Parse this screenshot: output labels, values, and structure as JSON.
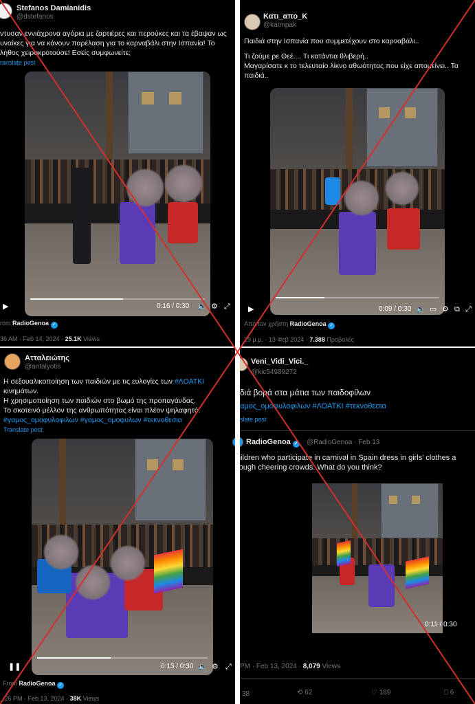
{
  "posts": [
    {
      "name": "Stefanos Damianidis",
      "handle": "@dstefanos",
      "text_lines": [
        "ντυσαν εννιάχρονα αγόρια με ζαρτιέρες και περούκες και τα έβαψαν ως",
        "υναίκες για να κάνουν παρέλαση για το καρναβάλι στην Ισπανία! Το",
        "λήθος χειροκροτούσε! Εσείς συμφωνείτε;"
      ],
      "translate": "ranslate post",
      "time": "0:16 / 0:30",
      "progress": 0.53,
      "source_prefix": "rom",
      "source_name": "RadioGenoa",
      "meta_date": "36 AM · Feb 14, 2024 · ",
      "meta_views": "25.1K",
      "meta_views_label": " Views"
    },
    {
      "name": "Κατι_απο_Κ",
      "handle": "@katmpak",
      "text_lines": [
        "Παιδιά στην Ισπανία που συμμετέχουν στο καρναβάλι..",
        "",
        "Τι ζούμε ρε Θεέ.... Τι κατάντια θλιβερή..",
        "Μαγαρίσατε κ το τελευταίο λίκνο αθωότητας που είχε απομείνει.. Τα",
        "παιδιά.."
      ],
      "time": "0:09 / 0:30",
      "progress": 0.3,
      "source_prefix": "Από τον χρήστη",
      "source_name": "RadioGenoa",
      "meta_date": "29 μ.μ. · 13 Φεβ 2024 · ",
      "meta_views": "7.388",
      "meta_views_label": " Προβολές"
    },
    {
      "name": "Ατταλειώτης",
      "handle": "@antalyotis",
      "text_lines": [
        "Η σεξουαλικοποίηση των παιδιών με τις ευλογίες των ",
        "κινημάτων.",
        "Η χρησιμοποίηση των παιδιών στο βωμό της προπαγάνδας.",
        "Το σκοτεινό μέλλον της ανθρωπότητας είναι πλέον ψηλαφητό."
      ],
      "inline_tag": "#ΛΟΑΤΚΙ",
      "tags_line": "#γαμος_ομοφυλοφιλων #γαμος_ομοφυλων #τεκνοθεσια",
      "translate": "Translate post",
      "time": "0:13 / 0:30",
      "progress": 0.43,
      "source_prefix": "From",
      "source_name": "RadioGenoa",
      "meta_date": ":26 PM · Feb 13, 2024 · ",
      "meta_views": "38K",
      "meta_views_label": " Views"
    },
    {
      "name": "Veni_Vidi_Vici._",
      "handle": "@kic54989272",
      "text": "διά βορά στα μάτια των παιδοφίλων",
      "tags_line": "αμος_ομοφυλοφιλων #ΛΟΑΤΚΙ #τεκνοθεσια",
      "translate": "slate post",
      "quote": {
        "name": "RadioGenoa",
        "handle_date": "@RadioGenoa · Feb 13",
        "text_lines": [
          "hildren who participate in carnival in Spain dress in girls' clothes a",
          "rough cheering crowds. What do you think?"
        ],
        "time": "0:11 / 0:30"
      },
      "meta_date": "PM · Feb 13, 2024 · ",
      "meta_views": "8,079",
      "meta_views_label": " Views",
      "actions": {
        "replies": "38",
        "reposts": "62",
        "likes": "189",
        "bookmarks": "6"
      }
    }
  ],
  "colors": {
    "cross": "#d32f2f",
    "link": "#1d9bf0"
  }
}
